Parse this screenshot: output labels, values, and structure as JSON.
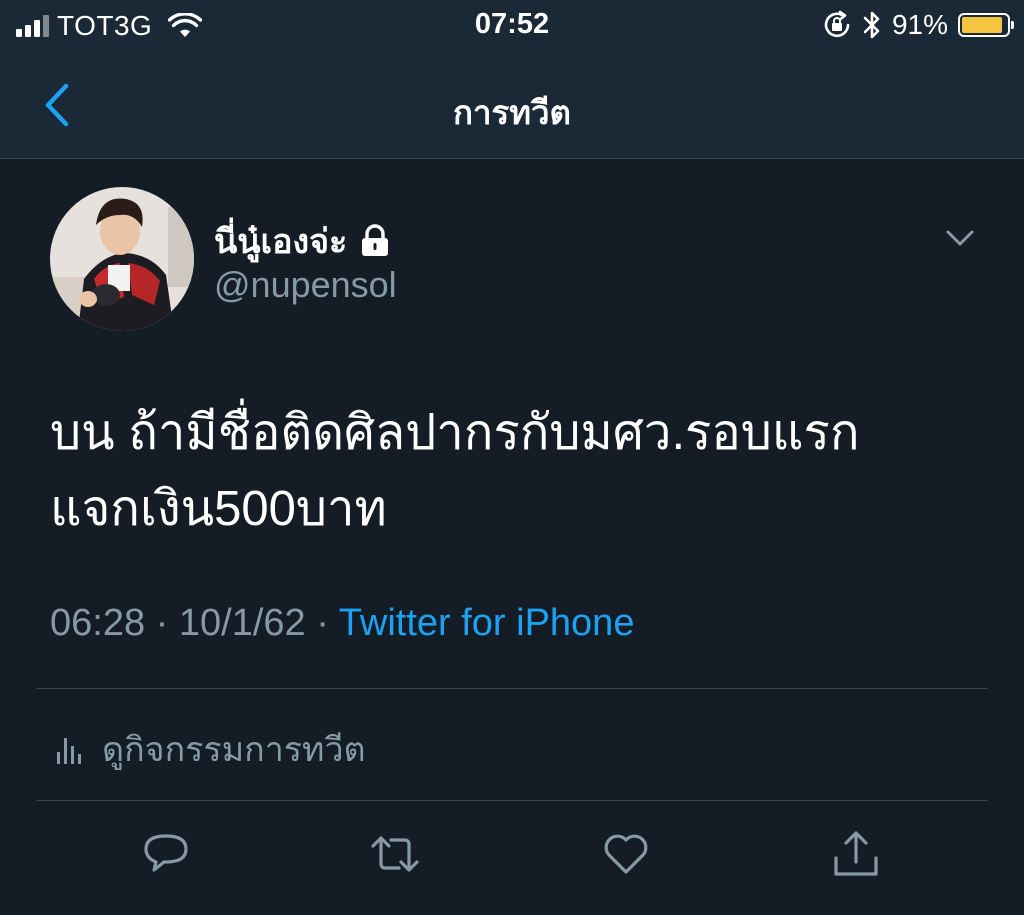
{
  "status_bar": {
    "carrier": "TOT3G",
    "time": "07:52",
    "battery_percent": "91%",
    "battery_level": 0.91,
    "battery_color": "#f5c542",
    "icons": [
      "signal-bars-icon",
      "wifi-icon",
      "rotation-lock-icon",
      "bluetooth-icon",
      "battery-icon"
    ]
  },
  "nav": {
    "title": "การทวีต",
    "back_icon": "chevron-left-icon"
  },
  "tweet": {
    "display_name": "นี่นู๋เองจ่ะ",
    "protected_icon": "lock-icon",
    "username": "@nupensol",
    "text": "บน ถ้ามีชื่อติดศิลปากรกับมศว.รอบแรก\nแจกเงิน500บาท",
    "time": "06:28",
    "date": "10/1/62",
    "separator": "·",
    "source": "Twitter for iPhone",
    "activity_label": "ดูกิจกรรมการทวีต",
    "activity_icon": "analytics-bars-icon"
  },
  "actions": [
    "reply-icon",
    "retweet-icon",
    "like-icon",
    "share-icon"
  ],
  "colors": {
    "background": "#141d26",
    "bar": "#1b2836",
    "accent": "#1da1f2",
    "secondary_text": "#8899a6",
    "divider": "#38444d"
  }
}
